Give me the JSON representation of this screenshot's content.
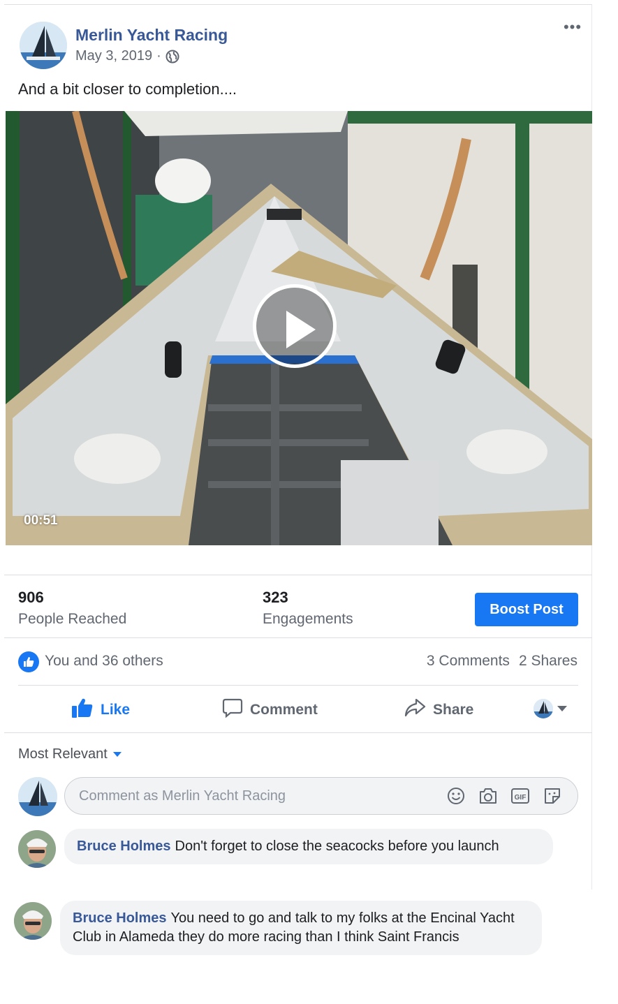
{
  "post": {
    "page_name": "Merlin Yacht Racing",
    "date": "May 3, 2019",
    "date_separator": "·",
    "privacy_icon": "globe-icon",
    "more_label": "•••",
    "text": "And a bit closer to completion....",
    "video_duration": "00:51"
  },
  "insights": {
    "reached_value": "906",
    "reached_label": "People Reached",
    "engagements_value": "323",
    "engagements_label": "Engagements",
    "boost_label": "Boost Post"
  },
  "reactions": {
    "summary": "You and 36 others",
    "comments": "3 Comments",
    "shares": "2 Shares"
  },
  "actions": {
    "like": "Like",
    "comment": "Comment",
    "share": "Share"
  },
  "comments_section": {
    "sort_label": "Most Relevant",
    "input_placeholder": "Comment as Merlin Yacht Racing",
    "icons": [
      "emoji-icon",
      "camera-icon",
      "gif-icon",
      "sticker-icon"
    ],
    "items": [
      {
        "author": "Bruce Holmes",
        "text": "Don't forget to close the seacocks before you launch"
      },
      {
        "author": "Bruce Holmes",
        "text": "You need to go and talk to my folks at the Encinal Yacht Club in Alameda they do more racing than I think Saint Francis"
      }
    ]
  },
  "colors": {
    "brand_blue": "#1877f2",
    "name_blue": "#385898",
    "muted_text": "#606770",
    "bubble_bg": "#f2f3f5"
  }
}
